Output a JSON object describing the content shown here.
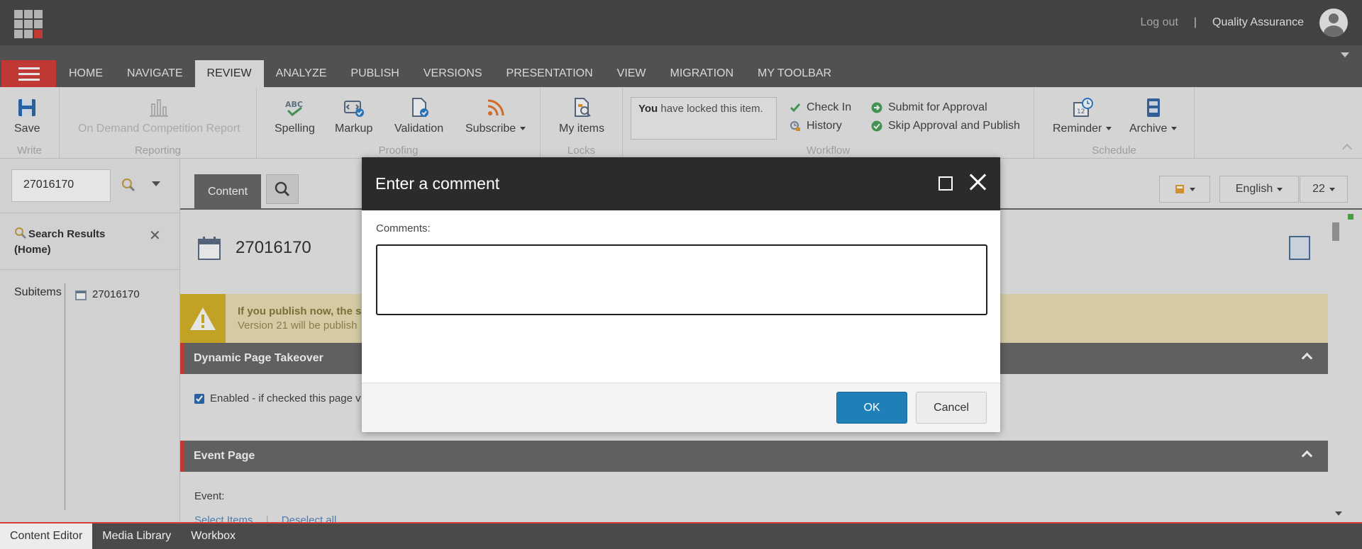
{
  "topbar": {
    "logout": "Log out",
    "separator": "|",
    "user": "Quality Assurance"
  },
  "tabs": [
    {
      "label": "HOME"
    },
    {
      "label": "NAVIGATE"
    },
    {
      "label": "REVIEW",
      "active": true
    },
    {
      "label": "ANALYZE"
    },
    {
      "label": "PUBLISH"
    },
    {
      "label": "VERSIONS"
    },
    {
      "label": "PRESENTATION"
    },
    {
      "label": "VIEW"
    },
    {
      "label": "MIGRATION"
    },
    {
      "label": "MY TOOLBAR"
    }
  ],
  "ribbon": {
    "write": {
      "label": "Write",
      "save": "Save"
    },
    "reporting": {
      "label": "Reporting",
      "report": "On Demand Competition Report"
    },
    "proofing": {
      "label": "Proofing",
      "spelling": "Spelling",
      "markup": "Markup",
      "validation": "Validation",
      "subscribe": "Subscribe"
    },
    "locks": {
      "label": "Locks",
      "my_items": "My items"
    },
    "workflow": {
      "label": "Workflow",
      "lock_bold": "You",
      "lock_rest": " have locked this item.",
      "check_in": "Check In",
      "history": "History",
      "submit": "Submit for Approval",
      "skip": "Skip Approval and Publish"
    },
    "schedule": {
      "label": "Schedule",
      "reminder": "Reminder",
      "archive": "Archive"
    }
  },
  "left": {
    "search_value": "27016170",
    "results_title": "Search Results",
    "results_scope": "(Home)",
    "subitems_label": "Subitems",
    "subitem": "27016170"
  },
  "editor": {
    "tab_content": "Content",
    "tool_language": "English",
    "tool_version": "22",
    "item_title": "27016170",
    "warning_line1": "If you publish now, the s",
    "warning_line2": "Version 21 will be publish",
    "section1": "Dynamic Page Takeover",
    "enabled_label": "Enabled - if checked this page v",
    "section2": "Event Page",
    "event_label": "Event:",
    "select_items": "Select Items",
    "deselect_all": "Deselect all"
  },
  "modal": {
    "title": "Enter a comment",
    "comments_label": "Comments:",
    "comment_value": "",
    "ok": "OK",
    "cancel": "Cancel"
  },
  "bottombar": [
    {
      "label": "Content Editor",
      "active": true
    },
    {
      "label": "Media Library"
    },
    {
      "label": "Workbox"
    }
  ],
  "colors": {
    "accent_red": "#d6403a",
    "ok_blue": "#1f7fb7",
    "warning_yellow": "#d8b52a"
  }
}
